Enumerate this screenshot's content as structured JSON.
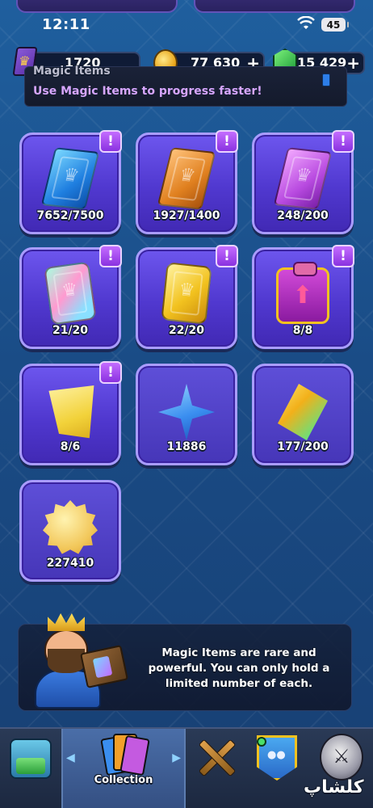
{
  "status_bar": {
    "time": "12:11",
    "battery": "45"
  },
  "resources": {
    "trophies": "1720",
    "gold": "77 630",
    "gems": "15 429",
    "plus": "+"
  },
  "header": {
    "title": "Magic Items",
    "subtitle": "Use Magic Items to progress faster!"
  },
  "items": [
    {
      "name": "Common Wild Card",
      "count": "7652/7500",
      "alert": "!"
    },
    {
      "name": "Rare Wild Card",
      "count": "1927/1400",
      "alert": "!"
    },
    {
      "name": "Epic Wild Card",
      "count": "248/200",
      "alert": "!"
    },
    {
      "name": "Legendary Wild Card",
      "count": "21/20",
      "alert": "!"
    },
    {
      "name": "Champion Wild Card",
      "count": "22/20",
      "alert": "!"
    },
    {
      "name": "Evolution Shard Chest",
      "count": "8/8",
      "alert": "!"
    },
    {
      "name": "Evolution Shard",
      "count": "8/6",
      "alert": "!"
    },
    {
      "name": "Star Points",
      "count": "11886"
    },
    {
      "name": "Elite Wild Card",
      "count": "177/200"
    },
    {
      "name": "Gold Badge",
      "count": "227410"
    }
  ],
  "info": {
    "line1": "Magic Items are rare and",
    "line2": "powerful. You can only hold a",
    "line3": "limited number of each."
  },
  "nav": {
    "collection_label": "Collection",
    "left_arrow": "◀",
    "right_arrow": "▶"
  },
  "watermark": "کلشاپ"
}
